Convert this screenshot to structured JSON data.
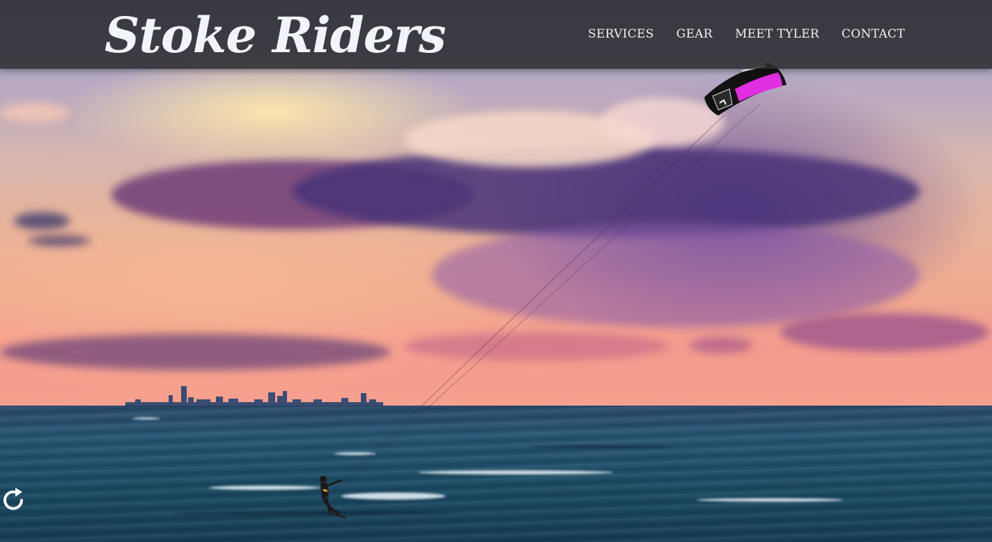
{
  "header": {
    "logo_text": "Stoke Riders",
    "nav": [
      {
        "label": "SERVICES"
      },
      {
        "label": "GEAR"
      },
      {
        "label": "MEET TYLER"
      },
      {
        "label": "CONTACT"
      }
    ]
  },
  "hero": {
    "icons": [
      "kite-icon",
      "kitesurfer-icon",
      "city-skyline-icon",
      "reload-icon"
    ]
  },
  "colors": {
    "header_bg": "#2d2d32",
    "nav_text": "#f3f3f3",
    "logo_text": "#f1f4fa",
    "kite_accent": "#e12ee0"
  }
}
